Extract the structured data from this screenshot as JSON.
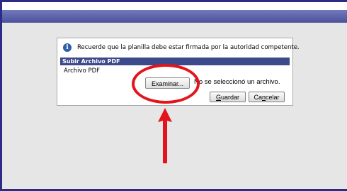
{
  "dialog": {
    "notice": "Recuerde que la planilla debe estar firmada por la autoridad competente.",
    "section_title": "Subir Archivo PDF",
    "field_label": "Archivo PDF",
    "browse_button": "Examinar...",
    "file_status": "No se seleccionó un archivo.",
    "save_button": {
      "mnemonic": "G",
      "rest": "uardar"
    },
    "cancel_button": {
      "prefix": "Ca",
      "mnemonic": "n",
      "rest": "celar"
    }
  },
  "colors": {
    "top_bar": "#4a519a",
    "section_header": "#3c4a8c",
    "annotation": "#e3141b",
    "info_icon": "#2f5fa8"
  },
  "icons": {
    "notice": "info-icon"
  },
  "annotations": [
    "red-ellipse",
    "red-arrow"
  ]
}
